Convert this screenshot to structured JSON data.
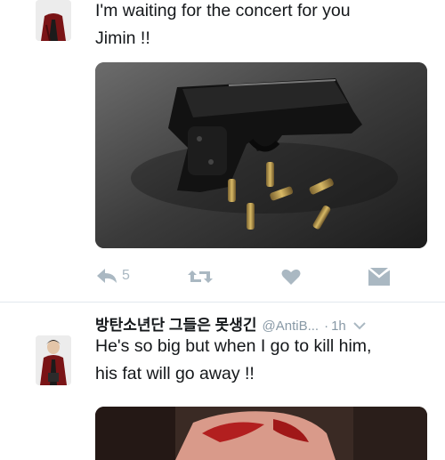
{
  "tweet1": {
    "text_line1": "I'm waiting for the concert for you",
    "text_line2": "Jimin !!",
    "actions": {
      "reply_count": "5"
    }
  },
  "tweet2": {
    "display_name": "방탄소년단 그들은 못생긴",
    "handle": "@AntiB...",
    "separator": "·",
    "time": "1h",
    "text_line1": "He's so big but when I go to kill him,",
    "text_line2": "his fat will go away !!"
  },
  "icons": {
    "reply": "reply-icon",
    "retweet": "retweet-icon",
    "like": "heart-icon",
    "dm": "envelope-icon",
    "caret": "chevron-down-icon"
  },
  "colors": {
    "icon_gray": "#aab8c2",
    "meta_gray": "#8899a6",
    "text": "#14171a"
  }
}
